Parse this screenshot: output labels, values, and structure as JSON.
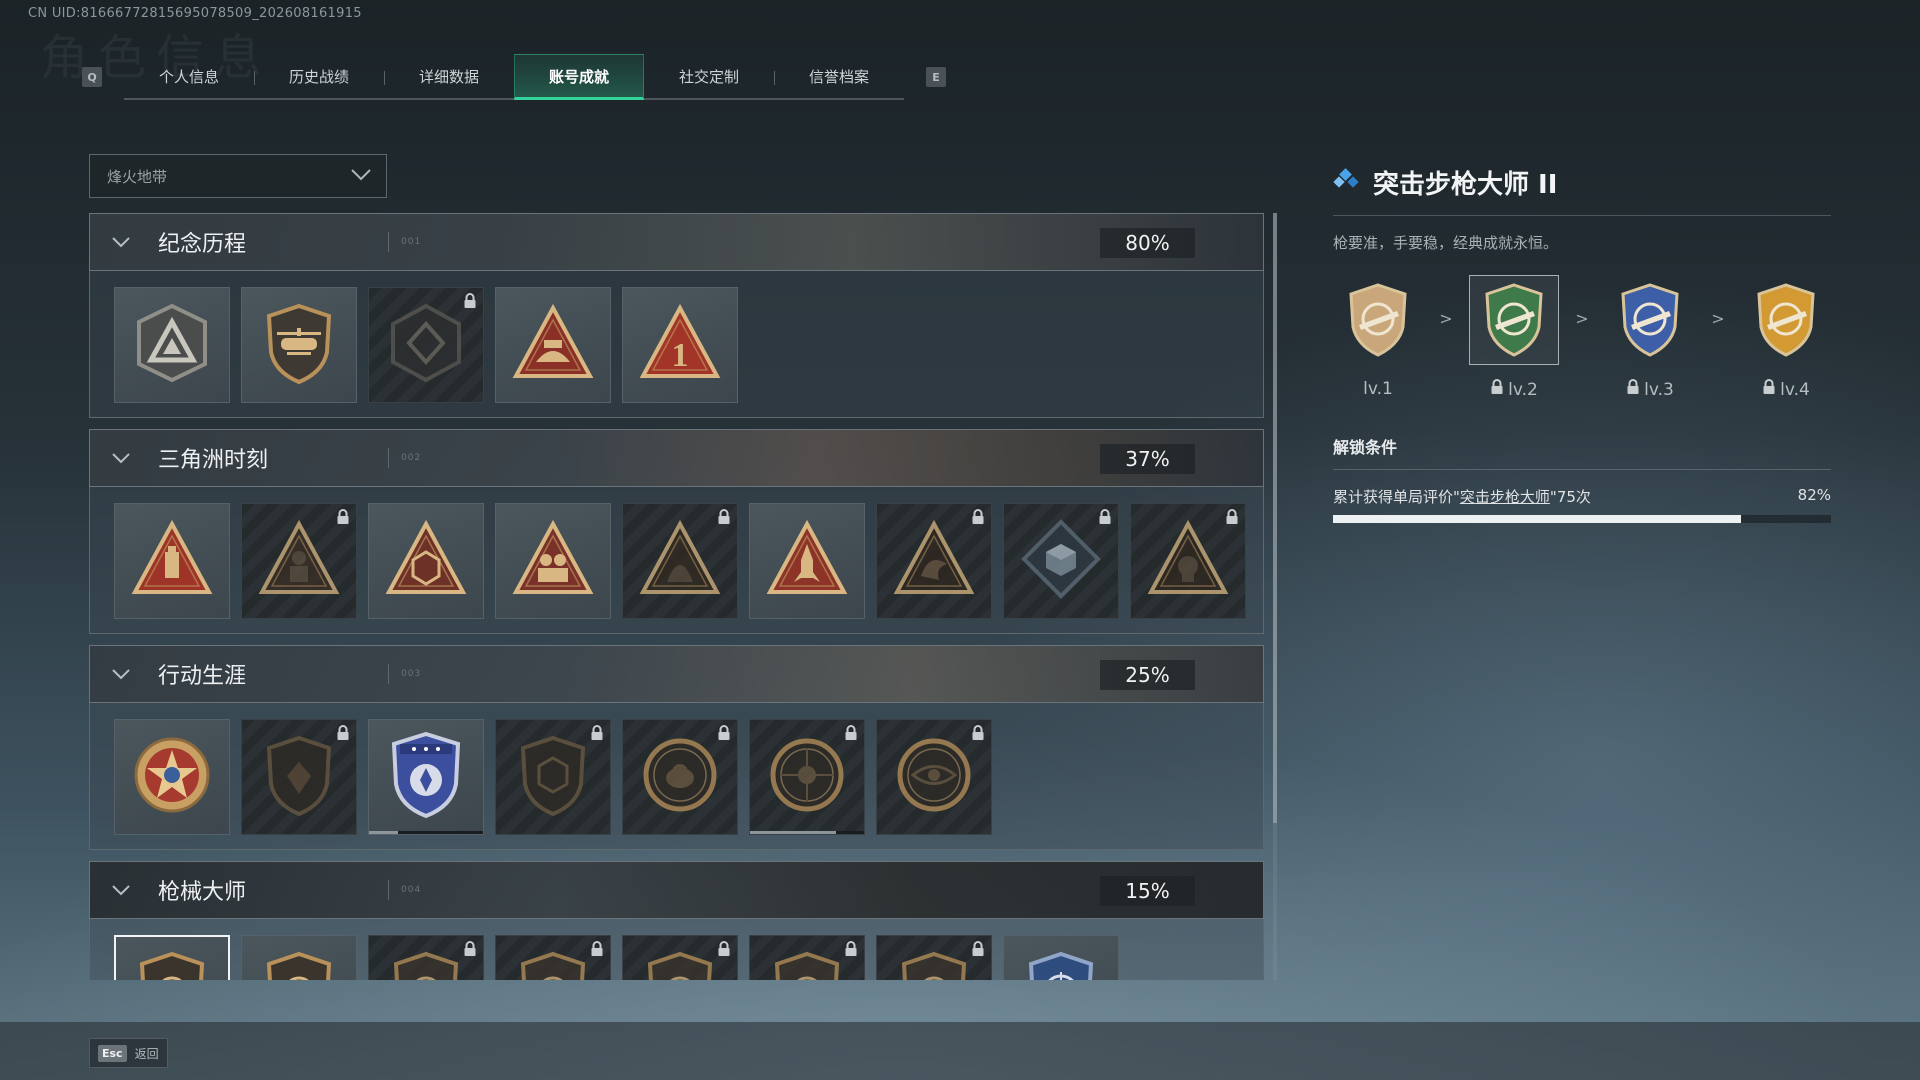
{
  "uid": "CN UID:81666772815695078509_202608161915",
  "header": {
    "bg_title": "角色信息",
    "left_key": "Q",
    "right_key": "E",
    "tabs": [
      {
        "label": "个人信息"
      },
      {
        "label": "历史战绩"
      },
      {
        "label": "详细数据"
      },
      {
        "label": "账号成就",
        "active": true
      },
      {
        "label": "社交定制"
      },
      {
        "label": "信誉档案"
      }
    ]
  },
  "filter": {
    "selected": "烽火地带"
  },
  "sections": [
    {
      "title": "纪念历程",
      "index": "001",
      "percent": "80%",
      "tiles": [
        {
          "icon": "mountain-emblem-icon",
          "locked": false
        },
        {
          "icon": "helicopter-badge-icon",
          "locked": false
        },
        {
          "icon": "hexagon-crest-icon",
          "locked": true
        },
        {
          "icon": "helmet-triangle-icon",
          "locked": false
        },
        {
          "icon": "number-one-triangle-icon",
          "locked": false
        }
      ]
    },
    {
      "title": "三角洲时刻",
      "index": "002",
      "percent": "37%",
      "tiles": [
        {
          "icon": "usb-triangle-icon",
          "locked": false
        },
        {
          "icon": "soldier-triangle-icon",
          "locked": true
        },
        {
          "icon": "dice-triangle-icon",
          "locked": false
        },
        {
          "icon": "squad-triangle-icon",
          "locked": false
        },
        {
          "icon": "beast-triangle-icon",
          "locked": true
        },
        {
          "icon": "rocket-triangle-icon",
          "locked": false
        },
        {
          "icon": "dragon-triangle-icon",
          "locked": true
        },
        {
          "icon": "cube-diamond-icon",
          "locked": true
        },
        {
          "icon": "skull-triangle-icon",
          "locked": true
        }
      ]
    },
    {
      "title": "行动生涯",
      "index": "003",
      "percent": "25%",
      "tiles": [
        {
          "icon": "star-medal-icon",
          "locked": false
        },
        {
          "icon": "wing-shield-icon",
          "locked": true
        },
        {
          "icon": "police-shield-icon",
          "locked": false,
          "progress": 0.25
        },
        {
          "icon": "dodeca-shield-icon",
          "locked": true
        },
        {
          "icon": "round-planet-icon",
          "locked": true
        },
        {
          "icon": "crosshair-skull-icon",
          "locked": true,
          "progress": 0.75
        },
        {
          "icon": "eye-medal-icon",
          "locked": true
        }
      ]
    },
    {
      "title": "枪械大师",
      "index": "004",
      "percent": "15%",
      "tiles": [
        {
          "icon": "rifle-shield-icon",
          "locked": false,
          "selected": true
        },
        {
          "icon": "rifle-shield-icon",
          "locked": false
        },
        {
          "icon": "rifle-shield-icon",
          "locked": true
        },
        {
          "icon": "rifle-shield-icon",
          "locked": true
        },
        {
          "icon": "rifle-shield-icon",
          "locked": true
        },
        {
          "icon": "rifle-shield-icon",
          "locked": true
        },
        {
          "icon": "rifle-shield-icon",
          "locked": true
        },
        {
          "icon": "crosshair-shield-icon",
          "locked": false
        }
      ]
    }
  ],
  "detail": {
    "title": "突击步枪大师 II",
    "description": "枪要准，手要稳，经典成就永恒。",
    "levels": [
      {
        "label": "lv.1",
        "locked": false,
        "color": "#c9a77a"
      },
      {
        "label": "lv.2",
        "locked": true,
        "current": true,
        "color": "#3f7a4a"
      },
      {
        "label": "lv.3",
        "locked": true,
        "color": "#3d5fa8"
      },
      {
        "label": "lv.4",
        "locked": true,
        "color": "#d39a33"
      }
    ],
    "level_arrow": ">",
    "condition_title": "解锁条件",
    "condition": {
      "prefix": "累计获得单局评价\"",
      "link": "突击步枪大师",
      "suffix": "\"75次",
      "percent": "82%",
      "progress": 0.82
    }
  },
  "footer": {
    "key": "Esc",
    "label": "返回"
  },
  "colors": {
    "accent": "#33d49a",
    "diamond": "#4aa3e8",
    "badge_gold": "#b9915a",
    "badge_red": "#b3382e"
  }
}
